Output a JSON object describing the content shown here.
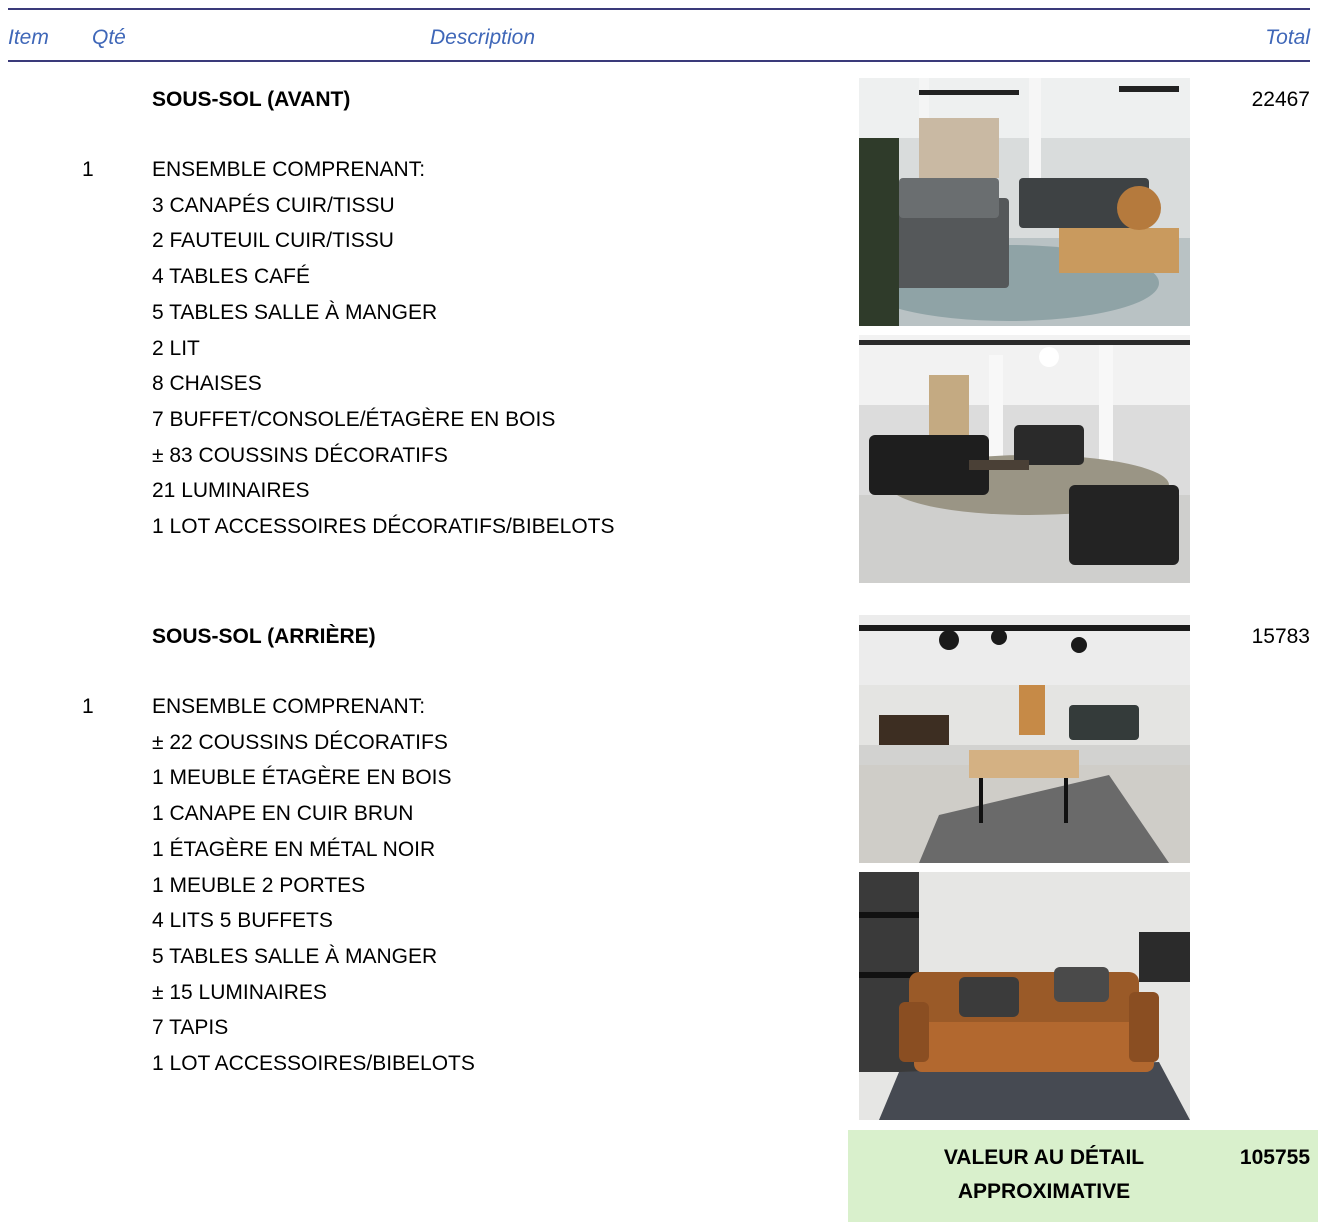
{
  "header": {
    "item": "Item",
    "qty": "Qté",
    "description": "Description",
    "total": "Total"
  },
  "sections": [
    {
      "title": "SOUS-SOL (AVANT)",
      "qty": "1",
      "total": "22467",
      "lines": [
        "ENSEMBLE COMPRENANT:",
        "3 CANAPÉS CUIR/TISSU",
        "2 FAUTEUIL CUIR/TISSU",
        "4 TABLES CAFÉ",
        "5 TABLES SALLE À MANGER",
        "2 LIT",
        "8 CHAISES",
        "7 BUFFET/CONSOLE/ÉTAGÈRE EN BOIS",
        "± 83 COUSSINS DÉCORATIFS",
        "21 LUMINAIRES",
        "1 LOT ACCESSOIRES DÉCORATIFS/BIBELOTS"
      ]
    },
    {
      "title": "SOUS-SOL (ARRIÈRE)",
      "qty": "1",
      "total": "15783",
      "lines": [
        "ENSEMBLE COMPRENANT:",
        "± 22 COUSSINS DÉCORATIFS",
        "1 MEUBLE ÉTAGÈRE EN BOIS",
        "1 CANAPE EN CUIR BRUN",
        "1 ÉTAGÈRE EN MÉTAL NOIR",
        "1 MEUBLE 2 PORTES",
        "4 LITS 5 BUFFETS",
        "5 TABLES SALLE À MANGER",
        "± 15 LUMINAIRES",
        "7 TAPIS",
        "1 LOT ACCESSOIRES/BIBELOTS"
      ]
    }
  ],
  "summary": {
    "label": "VALEUR AU DÉTAIL\nAPPROXIMATIVE",
    "value": "105755"
  },
  "colors": {
    "header_text": "#3f67b8",
    "rule": "#3a3a7a",
    "summary_bg": "#d9f0cc"
  }
}
